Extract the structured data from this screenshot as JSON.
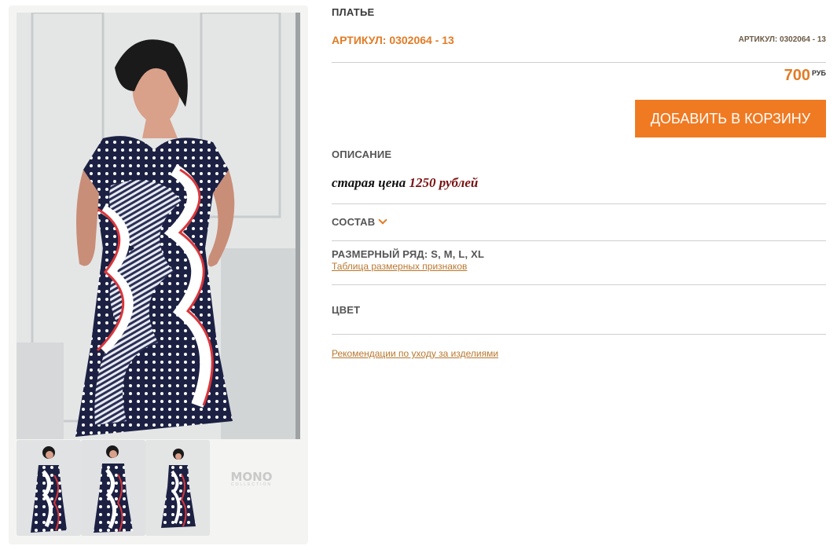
{
  "product": {
    "type": "ПЛАТЬЕ",
    "sku_label": "АРТИКУЛ: 0302064 - 13",
    "sku_small": "АРТИКУЛ: 0302064 - 13",
    "price": "700",
    "currency": "РУБ",
    "add_to_cart": "ДОБАВИТЬ В КОРЗИНУ"
  },
  "description": {
    "title": "ОПИСАНИЕ",
    "old_price_prefix": "старая цена",
    "old_price_value": "1250 рублей"
  },
  "composition": {
    "title": "СОСТАВ",
    "icon": "chevron-down-icon"
  },
  "sizes": {
    "title": "РАЗМЕРНЫЙ РЯД: S, M, L, XL",
    "table_link": "Таблица размерных признаков"
  },
  "color": {
    "title": "ЦВЕТ"
  },
  "care_link": "Рекомендации по уходу за изделиями",
  "gallery": {
    "logo": "MONO",
    "logo_sub": "COLLECTION",
    "thumbnail_count": 3
  },
  "colors": {
    "accent": "#f07a22",
    "link": "#b9782f",
    "old_price": "#7a1010"
  }
}
